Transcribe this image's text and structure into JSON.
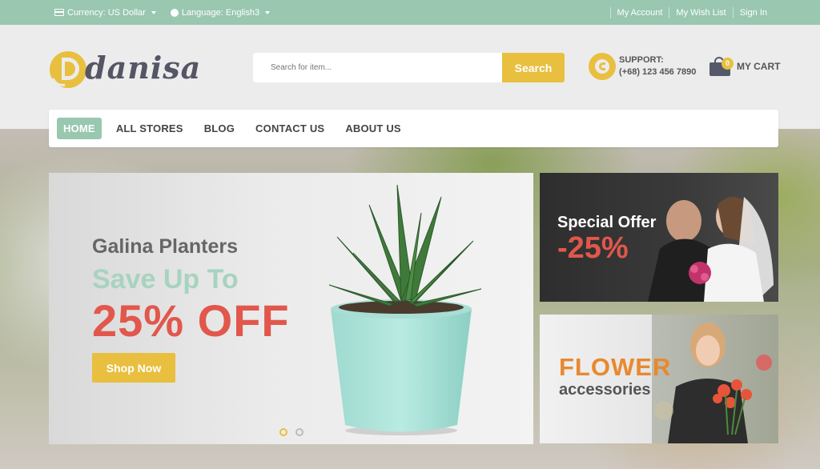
{
  "topbar": {
    "currency": "Currency: US Dollar",
    "language": "Language: English3",
    "links": [
      "My Account",
      "My Wish List",
      "Sign In"
    ]
  },
  "logo": {
    "wordmark": "danisa"
  },
  "search": {
    "placeholder": "Search for item...",
    "button": "Search"
  },
  "support": {
    "label": "SUPPORT:",
    "phone": "(+68) 123 456 7890"
  },
  "cart": {
    "label": "MY CART",
    "count": "0"
  },
  "nav": {
    "items": [
      "HOME",
      "ALL STORES",
      "BLOG",
      "CONTACT US",
      "ABOUT US"
    ],
    "active": "HOME"
  },
  "slider": {
    "subtitle": "Galina Planters",
    "save": "Save Up To",
    "offer": "25% OFF",
    "button": "Shop Now",
    "slides": 2,
    "active_slide": 1
  },
  "banner_special": {
    "title": "Special Offer",
    "discount": "-25%"
  },
  "banner_flower": {
    "title": "FLOWER",
    "subtitle": "accessories"
  },
  "colors": {
    "accent_green": "#99c7b0",
    "accent_yellow": "#e8bf3f",
    "accent_red": "#e2574c",
    "accent_orange": "#e8892f"
  }
}
